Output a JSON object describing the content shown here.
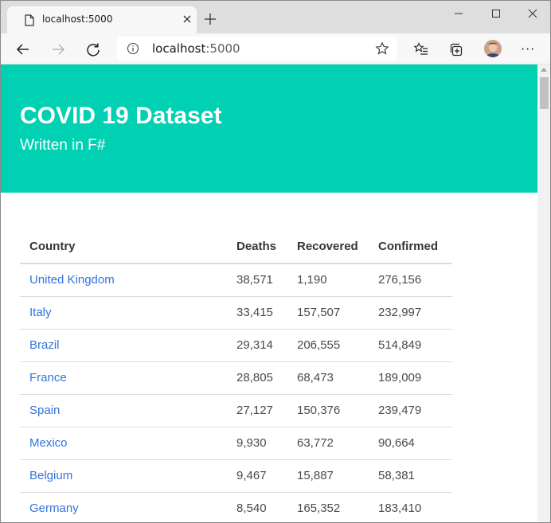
{
  "browser": {
    "tab": {
      "title": "localhost:5000",
      "icon": "page-icon",
      "close_icon": "close-icon"
    },
    "new_tab_icon": "plus-icon",
    "window_controls": [
      "minimize-icon",
      "maximize-icon",
      "close-icon"
    ],
    "toolbar": {
      "back_icon": "back-arrow-icon",
      "forward_icon": "forward-arrow-icon",
      "refresh_icon": "refresh-icon",
      "address": {
        "host": "localhost",
        "port": ":5000"
      },
      "favorite_icon": "star-icon",
      "favorites_icon": "favorites-list-icon",
      "collections_icon": "collections-icon",
      "more_label": "···"
    }
  },
  "page": {
    "hero": {
      "title": "COVID 19 Dataset",
      "subtitle": "Written in F#",
      "background": "#00d1b2"
    },
    "table": {
      "headers": [
        "Country",
        "Deaths",
        "Recovered",
        "Confirmed"
      ],
      "rows": [
        [
          "United Kingdom",
          "38,571",
          "1,190",
          "276,156"
        ],
        [
          "Italy",
          "33,415",
          "157,507",
          "232,997"
        ],
        [
          "Brazil",
          "29,314",
          "206,555",
          "514,849"
        ],
        [
          "France",
          "28,805",
          "68,473",
          "189,009"
        ],
        [
          "Spain",
          "27,127",
          "150,376",
          "239,479"
        ],
        [
          "Mexico",
          "9,930",
          "63,772",
          "90,664"
        ],
        [
          "Belgium",
          "9,467",
          "15,887",
          "58,381"
        ],
        [
          "Germany",
          "8,540",
          "165,352",
          "183,410"
        ]
      ],
      "link_color": "#3273dc"
    }
  }
}
